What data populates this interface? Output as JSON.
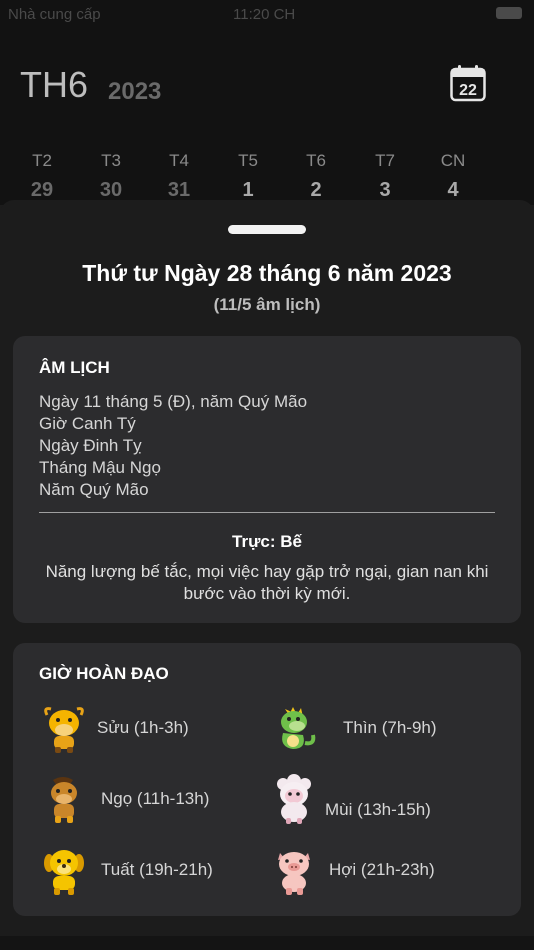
{
  "status_bar": {
    "carrier": "Nhà cung cấp",
    "time": "11:20 CH"
  },
  "header": {
    "month": "TH6",
    "year": "2023",
    "calendar_day": "22"
  },
  "week": [
    {
      "day": "T2",
      "date": "29"
    },
    {
      "day": "T3",
      "date": "30"
    },
    {
      "day": "T4",
      "date": "31"
    },
    {
      "day": "T5",
      "date": "1"
    },
    {
      "day": "T6",
      "date": "2"
    },
    {
      "day": "T7",
      "date": "3"
    },
    {
      "day": "CN",
      "date": "4"
    }
  ],
  "sheet": {
    "title": "Thứ tư Ngày 28 tháng 6 năm 2023",
    "subtitle": "(11/5 âm lịch)"
  },
  "lunar": {
    "heading": "ÂM LỊCH",
    "lines": [
      "Ngày 11 tháng 5 (Đ), năm Quý Mão",
      "Giờ Canh Tý",
      "Ngày Đinh Tỵ",
      "Tháng Mậu Ngọ",
      "Năm Quý Mão"
    ],
    "truc_title": "Trực: Bế",
    "truc_desc": "Năng lượng bế tắc, mọi việc hay gặp trở ngại, gian nan khi bước vào thời kỳ mới."
  },
  "hoang_dao": {
    "heading": "GIỜ HOÀN ĐẠO",
    "hours": [
      {
        "label": "Sửu (1h-3h)",
        "icon": "ox-icon"
      },
      {
        "label": "Thìn (7h-9h)",
        "icon": "dragon-icon"
      },
      {
        "label": "Ngọ (11h-13h)",
        "icon": "horse-icon"
      },
      {
        "label": "Mùi (13h-15h)",
        "icon": "goat-icon"
      },
      {
        "label": "Tuất (19h-21h)",
        "icon": "dog-icon"
      },
      {
        "label": "Hợi (21h-23h)",
        "icon": "pig-icon"
      }
    ]
  }
}
